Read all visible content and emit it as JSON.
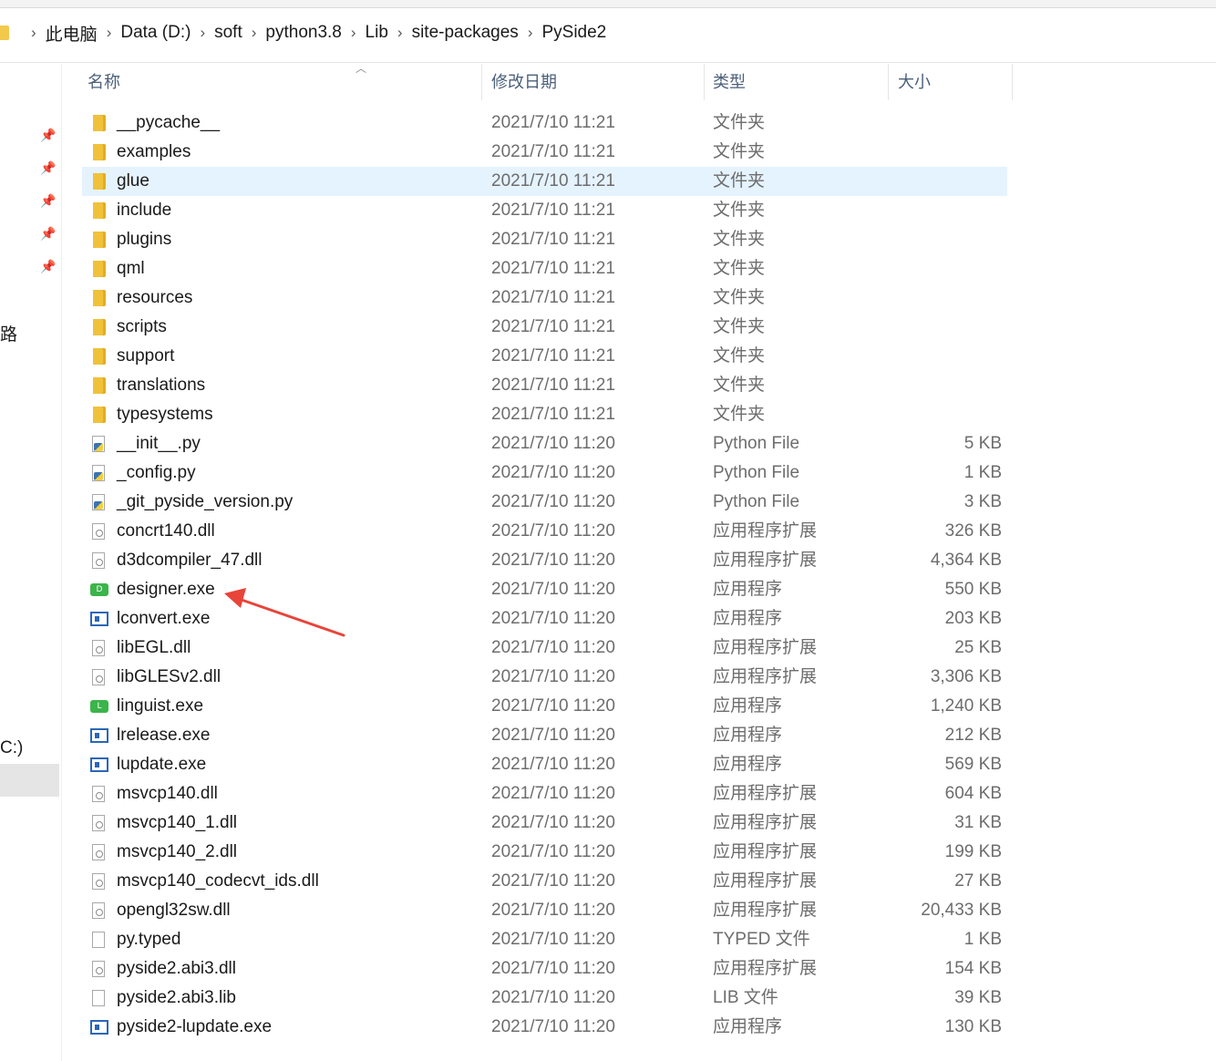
{
  "breadcrumb": [
    "此电脑",
    "Data (D:)",
    "soft",
    "python3.8",
    "Lib",
    "site-packages",
    "PySide2"
  ],
  "navigation_pane": {
    "partial_labels": [
      "路",
      "C:)"
    ]
  },
  "columns": {
    "name": "名称",
    "date": "修改日期",
    "type": "类型",
    "size": "大小"
  },
  "files": [
    {
      "name": "__pycache__",
      "date": "2021/7/10 11:21",
      "type": "文件夹",
      "size": "",
      "icon": "folder-icon"
    },
    {
      "name": "examples",
      "date": "2021/7/10 11:21",
      "type": "文件夹",
      "size": "",
      "icon": "folder-icon"
    },
    {
      "name": "glue",
      "date": "2021/7/10 11:21",
      "type": "文件夹",
      "size": "",
      "icon": "folder-icon"
    },
    {
      "name": "include",
      "date": "2021/7/10 11:21",
      "type": "文件夹",
      "size": "",
      "icon": "folder-icon"
    },
    {
      "name": "plugins",
      "date": "2021/7/10 11:21",
      "type": "文件夹",
      "size": "",
      "icon": "folder-icon"
    },
    {
      "name": "qml",
      "date": "2021/7/10 11:21",
      "type": "文件夹",
      "size": "",
      "icon": "folder-icon"
    },
    {
      "name": "resources",
      "date": "2021/7/10 11:21",
      "type": "文件夹",
      "size": "",
      "icon": "folder-icon"
    },
    {
      "name": "scripts",
      "date": "2021/7/10 11:21",
      "type": "文件夹",
      "size": "",
      "icon": "folder-icon"
    },
    {
      "name": "support",
      "date": "2021/7/10 11:21",
      "type": "文件夹",
      "size": "",
      "icon": "folder-icon"
    },
    {
      "name": "translations",
      "date": "2021/7/10 11:21",
      "type": "文件夹",
      "size": "",
      "icon": "folder-icon"
    },
    {
      "name": "typesystems",
      "date": "2021/7/10 11:21",
      "type": "文件夹",
      "size": "",
      "icon": "folder-icon"
    },
    {
      "name": "__init__.py",
      "date": "2021/7/10 11:20",
      "type": "Python File",
      "size": "5 KB",
      "icon": "python-file-icon"
    },
    {
      "name": "_config.py",
      "date": "2021/7/10 11:20",
      "type": "Python File",
      "size": "1 KB",
      "icon": "python-file-icon"
    },
    {
      "name": "_git_pyside_version.py",
      "date": "2021/7/10 11:20",
      "type": "Python File",
      "size": "3 KB",
      "icon": "python-file-icon"
    },
    {
      "name": "concrt140.dll",
      "date": "2021/7/10 11:20",
      "type": "应用程序扩展",
      "size": "326 KB",
      "icon": "dll-icon"
    },
    {
      "name": "d3dcompiler_47.dll",
      "date": "2021/7/10 11:20",
      "type": "应用程序扩展",
      "size": "4,364 KB",
      "icon": "dll-icon"
    },
    {
      "name": "designer.exe",
      "date": "2021/7/10 11:20",
      "type": "应用程序",
      "size": "550 KB",
      "icon": "designer-app-icon",
      "glyph": "D"
    },
    {
      "name": "lconvert.exe",
      "date": "2021/7/10 11:20",
      "type": "应用程序",
      "size": "203 KB",
      "icon": "exe-icon"
    },
    {
      "name": "libEGL.dll",
      "date": "2021/7/10 11:20",
      "type": "应用程序扩展",
      "size": "25 KB",
      "icon": "dll-icon"
    },
    {
      "name": "libGLESv2.dll",
      "date": "2021/7/10 11:20",
      "type": "应用程序扩展",
      "size": "3,306 KB",
      "icon": "dll-icon"
    },
    {
      "name": "linguist.exe",
      "date": "2021/7/10 11:20",
      "type": "应用程序",
      "size": "1,240 KB",
      "icon": "linguist-app-icon",
      "glyph": "L"
    },
    {
      "name": "lrelease.exe",
      "date": "2021/7/10 11:20",
      "type": "应用程序",
      "size": "212 KB",
      "icon": "exe-icon"
    },
    {
      "name": "lupdate.exe",
      "date": "2021/7/10 11:20",
      "type": "应用程序",
      "size": "569 KB",
      "icon": "exe-icon"
    },
    {
      "name": "msvcp140.dll",
      "date": "2021/7/10 11:20",
      "type": "应用程序扩展",
      "size": "604 KB",
      "icon": "dll-icon"
    },
    {
      "name": "msvcp140_1.dll",
      "date": "2021/7/10 11:20",
      "type": "应用程序扩展",
      "size": "31 KB",
      "icon": "dll-icon"
    },
    {
      "name": "msvcp140_2.dll",
      "date": "2021/7/10 11:20",
      "type": "应用程序扩展",
      "size": "199 KB",
      "icon": "dll-icon"
    },
    {
      "name": "msvcp140_codecvt_ids.dll",
      "date": "2021/7/10 11:20",
      "type": "应用程序扩展",
      "size": "27 KB",
      "icon": "dll-icon"
    },
    {
      "name": "opengl32sw.dll",
      "date": "2021/7/10 11:20",
      "type": "应用程序扩展",
      "size": "20,433 KB",
      "icon": "dll-icon"
    },
    {
      "name": "py.typed",
      "date": "2021/7/10 11:20",
      "type": "TYPED 文件",
      "size": "1 KB",
      "icon": "file-icon"
    },
    {
      "name": "pyside2.abi3.dll",
      "date": "2021/7/10 11:20",
      "type": "应用程序扩展",
      "size": "154 KB",
      "icon": "dll-icon"
    },
    {
      "name": "pyside2.abi3.lib",
      "date": "2021/7/10 11:20",
      "type": "LIB 文件",
      "size": "39 KB",
      "icon": "file-icon"
    },
    {
      "name": "pyside2-lupdate.exe",
      "date": "2021/7/10 11:20",
      "type": "应用程序",
      "size": "130 KB",
      "icon": "exe-icon"
    }
  ],
  "selected_item": "glue",
  "highlighted_item": "designer.exe",
  "colors": {
    "selection": "#e5f3ff",
    "annotation_arrow": "#e8443a",
    "header_text": "#4c607a"
  }
}
